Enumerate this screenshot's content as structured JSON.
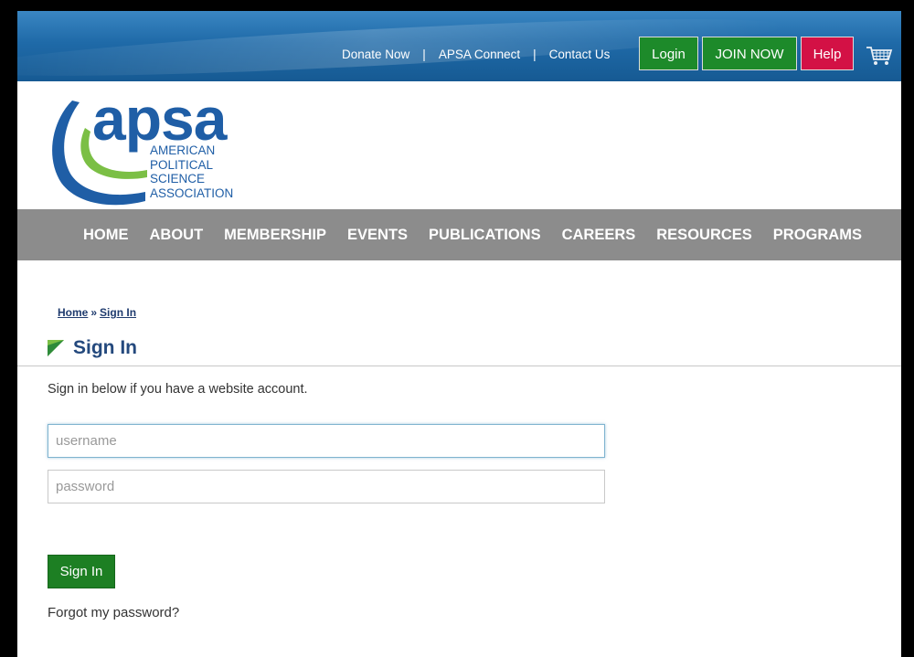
{
  "topbar": {
    "links": [
      "Donate Now",
      "APSA Connect",
      "Contact Us"
    ],
    "separator": "|",
    "login_label": "Login",
    "join_label": "JOIN NOW",
    "help_label": "Help",
    "cart_icon": "cart-icon"
  },
  "logo": {
    "word": "apsa",
    "lines": [
      "AMERICAN",
      "POLITICAL",
      "SCIENCE",
      "ASSOCIATION"
    ]
  },
  "nav": {
    "items": [
      "HOME",
      "ABOUT",
      "MEMBERSHIP",
      "EVENTS",
      "PUBLICATIONS",
      "CAREERS",
      "RESOURCES",
      "PROGRAMS"
    ]
  },
  "breadcrumb": {
    "home": "Home",
    "separator": "»",
    "current": "Sign In"
  },
  "page": {
    "title": "Sign In",
    "intro": "Sign in below if you have a website account."
  },
  "form": {
    "username_placeholder": "username",
    "username_value": "",
    "password_placeholder": "password",
    "password_value": "",
    "submit_label": "Sign In",
    "forgot_label": "Forgot my password?"
  },
  "colors": {
    "topbar_blue": "#1f6aa8",
    "brand_blue": "#1f5ea6",
    "brand_green": "#7bbf45",
    "button_green": "#1d8a2a",
    "help_red": "#d31145",
    "nav_gray": "#8c8c8c"
  }
}
